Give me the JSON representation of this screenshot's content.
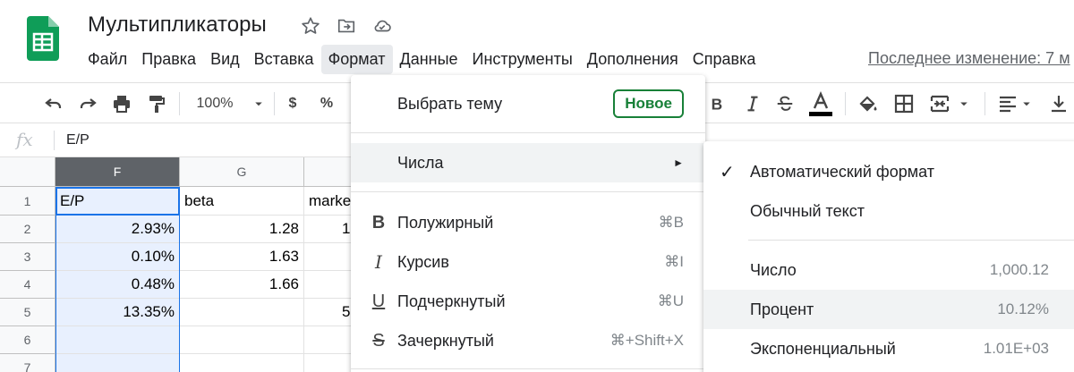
{
  "app": {
    "doc_title": "Мультипликаторы",
    "last_edit": "Последнее изменение: 7 м"
  },
  "menubar": [
    "Файл",
    "Правка",
    "Вид",
    "Вставка",
    "Формат",
    "Данные",
    "Инструменты",
    "Дополнения",
    "Справка"
  ],
  "toolbar": {
    "zoom": "100%",
    "currency": "$",
    "percent": "%"
  },
  "formula_bar": {
    "fx": "fx",
    "value": "E/P"
  },
  "columns": [
    "F",
    "G"
  ],
  "rows": [
    {
      "n": "1",
      "f": "E/P",
      "g": "beta",
      "h": "marke"
    },
    {
      "n": "2",
      "f": "2.93%",
      "g": "1.28",
      "h": "1"
    },
    {
      "n": "3",
      "f": "0.10%",
      "g": "1.63",
      "h": ""
    },
    {
      "n": "4",
      "f": "0.48%",
      "g": "1.66",
      "h": ""
    },
    {
      "n": "5",
      "f": "13.35%",
      "g": "",
      "h": "5"
    },
    {
      "n": "6",
      "f": "",
      "g": "",
      "h": ""
    },
    {
      "n": "7",
      "f": "",
      "g": "",
      "h": ""
    }
  ],
  "format_menu": {
    "theme": "Выбрать тему",
    "theme_badge": "Новое",
    "numbers": "Числа",
    "numbers_arrow": "►",
    "bold": {
      "icon": "B",
      "label": "Полужирный",
      "shortcut": "⌘B"
    },
    "italic": {
      "icon": "I",
      "label": "Курсив",
      "shortcut": "⌘I"
    },
    "underline": {
      "icon": "U",
      "label": "Подчеркнутый",
      "shortcut": "⌘U"
    },
    "strike": {
      "icon": "S",
      "label": "Зачеркнутый",
      "shortcut": "⌘+Shift+X"
    }
  },
  "numbers_menu": {
    "check": "✓",
    "auto": "Автоматический формат",
    "plain": "Обычный текст",
    "number": {
      "label": "Число",
      "example": "1,000.12"
    },
    "percent": {
      "label": "Процент",
      "example": "10.12%"
    },
    "scientific": {
      "label": "Экспоненциальный",
      "example": "1.01E+03"
    }
  }
}
